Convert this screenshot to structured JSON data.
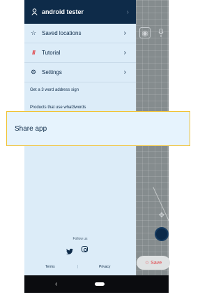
{
  "drawer": {
    "user": {
      "icon": "person-icon",
      "label": "android tester"
    },
    "items": [
      {
        "icon": "star-icon",
        "label": "Saved locations"
      },
      {
        "icon": "tutorial-icon",
        "icon_glyph": "///",
        "label": "Tutorial"
      },
      {
        "icon": "gear-icon",
        "label": "Settings"
      }
    ],
    "links": [
      "Get a 3 word address sign",
      "Products that use what3words"
    ],
    "follow_label": "Follow us",
    "social": [
      "twitter-icon",
      "instagram-icon"
    ],
    "footer": {
      "terms": "Terms",
      "separator": "|",
      "privacy": "Privacy"
    }
  },
  "highlight": {
    "label": "Share app"
  },
  "map": {
    "save_label": "Save",
    "save_icon": "star-outline-icon"
  },
  "colors": {
    "header_bg": "#0e2b49",
    "drawer_bg": "#dcecf8",
    "accent_red": "#e0474c",
    "highlight_border": "#f2c233",
    "navbar_bg": "#0b0c0f"
  }
}
